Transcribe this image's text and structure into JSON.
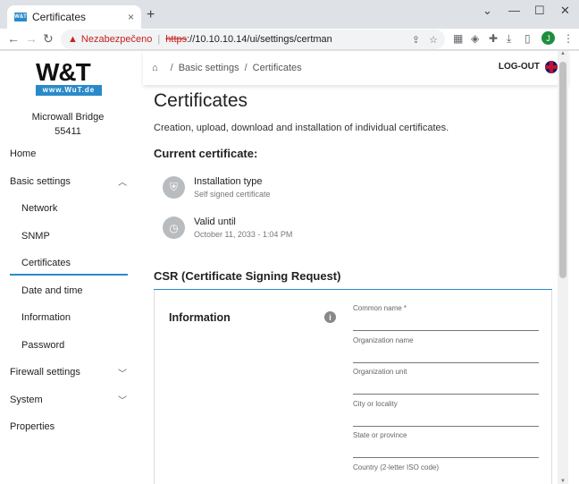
{
  "browser": {
    "tab_title": "Certificates",
    "favicon_text": "W&T",
    "tab_close": "×",
    "new_tab": "+",
    "window_controls": [
      "⌄",
      "—",
      "☐",
      "✕"
    ],
    "security_label": "Nezabezpečeno",
    "url_scheme": "https",
    "url_rest": "://10.10.10.14/ui/settings/certman",
    "profile_initial": "J"
  },
  "sidebar": {
    "logo_text": "W&T",
    "logo_sub": "www.WuT.de",
    "device_name": "Microwall Bridge",
    "device_id": "55411",
    "items": [
      {
        "label": "Home",
        "level": 0,
        "chevron": ""
      },
      {
        "label": "Basic settings",
        "level": 0,
        "chevron": "^"
      },
      {
        "label": "Network",
        "level": 1,
        "chevron": ""
      },
      {
        "label": "SNMP",
        "level": 1,
        "chevron": ""
      },
      {
        "label": "Certificates",
        "level": 1,
        "chevron": "",
        "active": true
      },
      {
        "label": "Date and time",
        "level": 1,
        "chevron": ""
      },
      {
        "label": "Information",
        "level": 1,
        "chevron": ""
      },
      {
        "label": "Password",
        "level": 1,
        "chevron": ""
      },
      {
        "label": "Firewall settings",
        "level": 0,
        "chevron": "v"
      },
      {
        "label": "System",
        "level": 0,
        "chevron": "v"
      },
      {
        "label": "Properties",
        "level": 0,
        "chevron": ""
      }
    ]
  },
  "header": {
    "breadcrumb": [
      "Basic settings",
      "Certificates"
    ],
    "logout": "LOG-OUT"
  },
  "main": {
    "title": "Certificates",
    "description": "Creation, upload, download and installation of individual certificates.",
    "current_heading": "Current certificate:",
    "installation_label": "Installation type",
    "installation_value": "Self signed certificate",
    "valid_label": "Valid until",
    "valid_value": "October 11, 2033 - 1:04 PM",
    "csr_heading": "CSR (Certificate Signing Request)",
    "info_title": "Information",
    "info_icon": "i",
    "fields": [
      "Common name *",
      "Organization name",
      "Organization unit",
      "City or locality",
      "State or province",
      "Country (2-letter ISO code)"
    ]
  }
}
